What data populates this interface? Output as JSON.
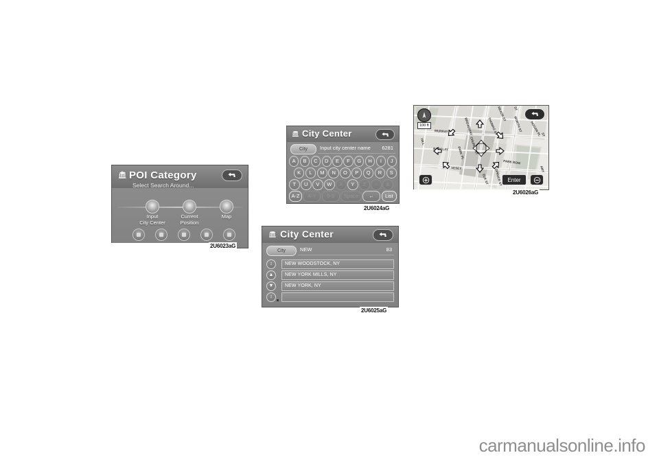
{
  "panels": {
    "poi_category": {
      "title": "POI Category",
      "subtitle": "Select Search Around...",
      "options": [
        {
          "label_line1": "Input",
          "label_line2": "City Center",
          "icon": "target-icon"
        },
        {
          "label_line1": "Current",
          "label_line2": "Position",
          "icon": "car-position-icon"
        },
        {
          "label_line1": "Map",
          "label_line2": "",
          "icon": "map-pin-icon"
        }
      ],
      "small_buttons": 5,
      "caption": "2U6023aG",
      "back_icon": "back-arrow-icon"
    },
    "city_center_keyboard": {
      "title": "City  Center",
      "tag_label": "City",
      "entry_text": "Input city center name",
      "match_count": "6281",
      "caption": "2U6024aG",
      "back_icon": "back-arrow-icon",
      "keyboard": {
        "row1": [
          "A",
          "B",
          "C",
          "D",
          "E",
          "F",
          "G",
          "H",
          "I",
          "J"
        ],
        "row2": [
          "K",
          "L",
          "M",
          "N",
          "O",
          "P",
          "Q",
          "R",
          "S"
        ],
        "row3": [
          "T",
          "U",
          "V",
          "W",
          "X",
          "Y",
          "Z",
          "-",
          "&"
        ],
        "row3_dim": [
          "X",
          "Z",
          "-",
          "&"
        ],
        "row4": [
          "A-Z",
          "A-Y",
          "0-9",
          "Space",
          "←",
          "List"
        ],
        "row4_dim": [
          "A-Y",
          "0-9",
          "Space"
        ]
      }
    },
    "city_center_list": {
      "title": "City Center",
      "tag_label": "City",
      "entry_text": "NEW",
      "match_count": "83",
      "caption": "2U6025aG",
      "back_icon": "back-arrow-icon",
      "scroll_buttons": [
        "↕",
        "▲",
        "▼",
        "↕"
      ],
      "items": [
        "NEW WOODSTOCK, NY",
        "NEW YORK MILLS, NY",
        "NEW YORK, NY",
        ""
      ]
    },
    "map": {
      "caption": "2U6026aG",
      "scale_label": "100 ft",
      "enter_label": "Enter",
      "zoom_in_icon": "zoom-in-icon",
      "zoom_out_icon": "zoom-out-icon",
      "back_icon": "back-arrow-icon",
      "compass_icon": "compass-icon",
      "cursor_icon": "map-cursor-icon",
      "streets": [
        "BROADWAY",
        "CHURCH ST",
        "THOMAS ST",
        "WORTH ST",
        "HOGAN PL",
        "LEONARD ST",
        "MURRAY ST",
        "BARCLAY ST",
        "VESEY ST",
        "PARK PL",
        "PARK ROW",
        "ELK ST",
        "SPRUCE ST",
        "DUANE ST",
        "READE ST"
      ],
      "arrow_markers": 8
    }
  },
  "watermark": "carmanualsonline.info",
  "colors": {
    "screen_bg": "#8a8a8a",
    "header_bg": "#7a7a7a",
    "text": "#ffffff",
    "map_bg": "#e9e9e6",
    "button_dark": "#2b2b2b"
  }
}
